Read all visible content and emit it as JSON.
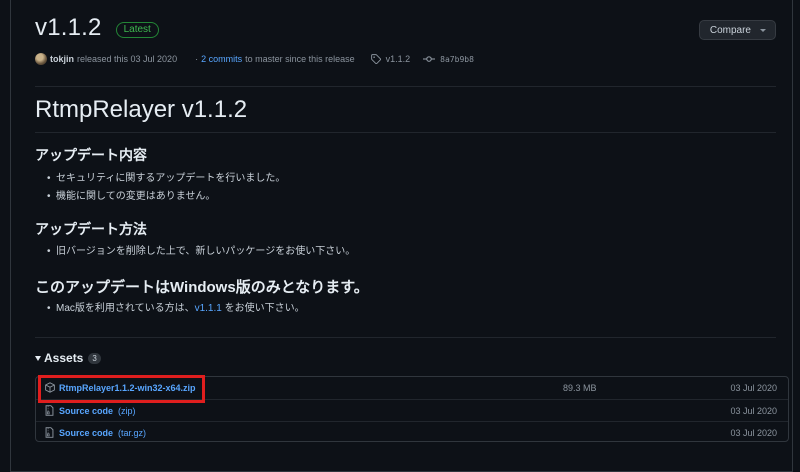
{
  "header": {
    "version": "v1.1.2",
    "badge": "Latest",
    "compare_label": "Compare"
  },
  "meta": {
    "author": "tokjin",
    "released_text": "released this 03 Jul 2020",
    "sep": "·",
    "commits_link": "2 commits",
    "commits_suffix": "to master since this release",
    "tag": "v1.1.2",
    "commit_hash": "8a7b9b8"
  },
  "release": {
    "title": "RtmpRelayer v1.1.2",
    "sections": [
      {
        "heading": "アップデート内容",
        "items": [
          "セキュリティに関するアップデートを行いました。",
          "機能に関しての変更はありません。"
        ]
      },
      {
        "heading": "アップデート方法",
        "items": [
          "旧バージョンを削除した上で、新しいパッケージをお使い下さい。"
        ]
      },
      {
        "heading": "このアップデートはWindows版のみとなります。",
        "items_note": {
          "before": "Mac版を利用されている方は、",
          "link": "v1.1.1",
          "after": " をお使い下さい。"
        }
      }
    ]
  },
  "assets": {
    "label": "Assets",
    "count": "3",
    "rows": [
      {
        "name": "RtmpRelayer1.1.2-win32-x64.zip",
        "sub": "",
        "size": "89.3 MB",
        "date": "03 Jul 2020",
        "icon": "package-icon"
      },
      {
        "name": "Source code",
        "sub": "(zip)",
        "size": "",
        "date": "03 Jul 2020",
        "icon": "file-zip-icon"
      },
      {
        "name": "Source code",
        "sub": "(tar.gz)",
        "size": "",
        "date": "03 Jul 2020",
        "icon": "file-zip-icon"
      }
    ]
  },
  "colors": {
    "accent_link": "#58a6ff",
    "badge_green": "#3fb950",
    "highlight_red": "#e01e1e",
    "background": "#0d1117"
  }
}
